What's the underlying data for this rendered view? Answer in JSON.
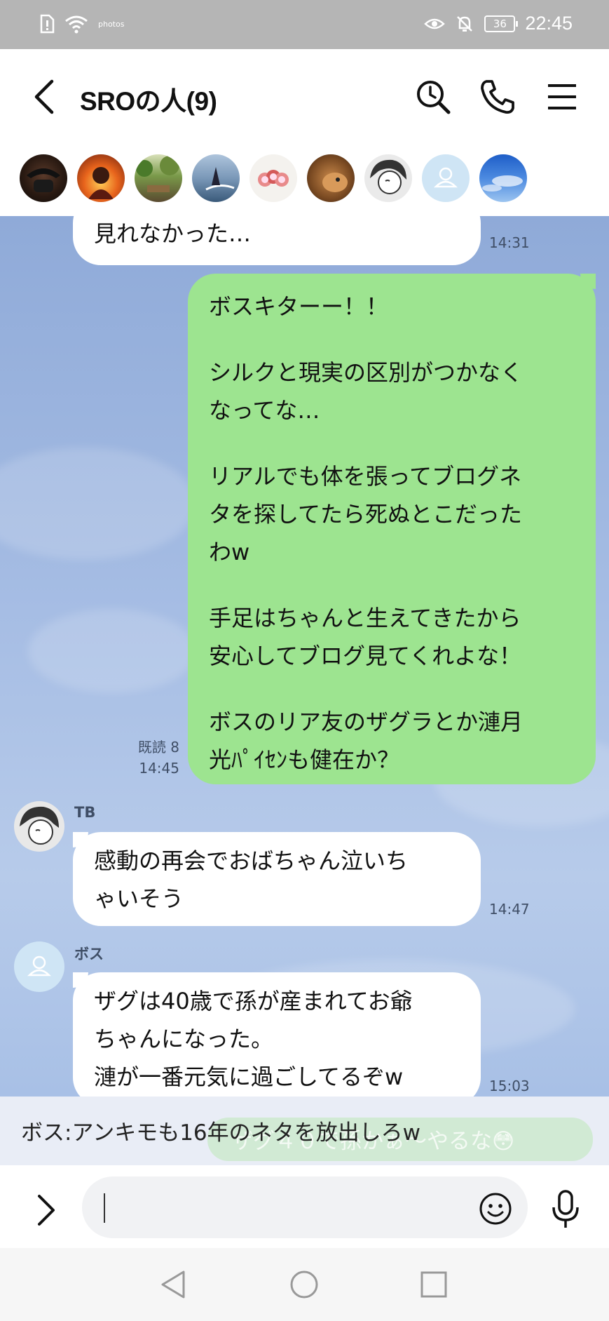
{
  "status_bar": {
    "time": "22:45",
    "battery": "36",
    "small_label": "photos"
  },
  "header": {
    "title": "SROの人(9)",
    "icons": [
      "back-arrow-icon",
      "search-history-icon",
      "phone-icon",
      "menu-icon"
    ]
  },
  "members": {
    "avatars": [
      "member-avatar-1",
      "member-avatar-2",
      "member-avatar-3",
      "member-avatar-4",
      "member-avatar-5",
      "member-avatar-6",
      "member-avatar-7",
      "member-avatar-8",
      "member-avatar-9"
    ]
  },
  "messages": [
    {
      "type": "incoming",
      "text": "見れなかった…",
      "time": "14:31"
    },
    {
      "type": "outgoing",
      "paragraphs": [
        [
          "ボスキターー！！"
        ],
        [
          "シルクと現実の区別がつかなく",
          "なってな…"
        ],
        [
          "リアルでも体を張ってブログネ",
          "タを探してたら死ぬとこだった",
          "わw"
        ],
        [
          "手足はちゃんと生えてきたから",
          "安心してブログ見てくれよな！"
        ],
        [
          "ボスのリア友のザグラとか漣月",
          "光ﾊﾟｲｾﾝも健在か？"
        ]
      ],
      "read": "既読 8",
      "time": "14:45"
    },
    {
      "type": "incoming",
      "sender": "TB",
      "lines": [
        "感動の再会でおばちゃん泣いち",
        "ゃいそう"
      ],
      "time": "14:47"
    },
    {
      "type": "incoming",
      "sender": "ボス",
      "lines": [
        "ザグは40歳で孫が産まれてお爺",
        "ちゃんになった。",
        "漣が一番元気に過ごしてるぞw"
      ],
      "time": "15:03"
    }
  ],
  "announcement": {
    "text": "ボス:アンキモも16年のネタを放出しろw",
    "ghost_text": "ザグ４０で孫かぁ〜やるな😳"
  },
  "input": {
    "placeholder": ""
  },
  "colors": {
    "outgoing_bubble": "#9de490",
    "incoming_bubble": "#ffffff",
    "chat_background": "#a6bde4"
  }
}
